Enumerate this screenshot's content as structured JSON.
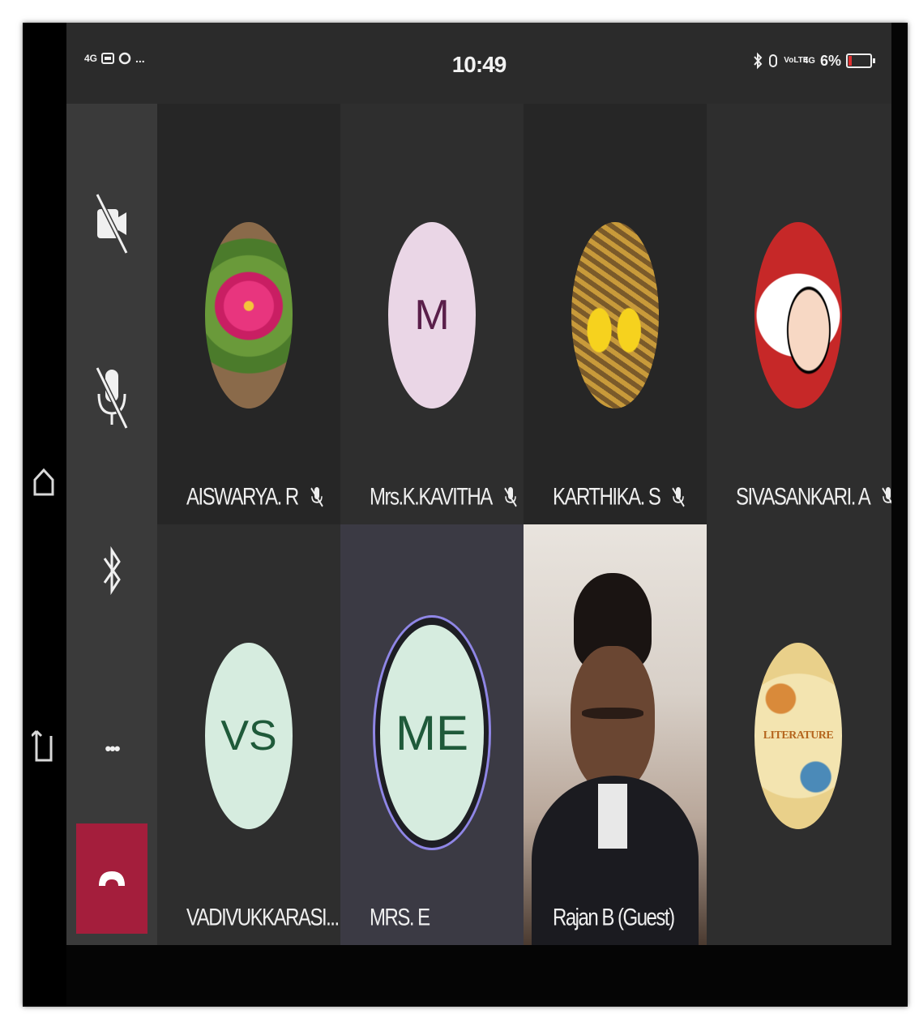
{
  "status_bar": {
    "left_indicators": [
      "4G",
      "msg",
      "whatsapp",
      "..."
    ],
    "time": "10:49",
    "right_indicators": [
      "bluetooth",
      "alarm",
      "VoLTE",
      "4G"
    ],
    "battery_percent": "6%"
  },
  "controls": [
    {
      "id": "camera",
      "icon": "camera-off-icon"
    },
    {
      "id": "microphone",
      "icon": "mic-off-icon"
    },
    {
      "id": "bluetooth",
      "icon": "bluetooth-icon"
    },
    {
      "id": "more",
      "icon": "more-icon",
      "label": "•••"
    },
    {
      "id": "hangup",
      "icon": "hangup-icon",
      "color": "#a41e3c"
    }
  ],
  "participants": [
    {
      "name": "AISWARYA. R",
      "avatar": "flower-photo",
      "muted": true
    },
    {
      "name": "Mrs.K.KAVITHA",
      "initials": "M",
      "avatar_color": "#ead6e6",
      "initials_color": "#5a1f4a",
      "muted": true
    },
    {
      "name": "KARTHIKA. S",
      "avatar": "chicks-photo",
      "muted": true
    },
    {
      "name": "SIVASANKARI. A",
      "avatar": "cartoon-photo",
      "muted": true
    },
    {
      "name": "VADIVUKKARASI...",
      "initials": "VS",
      "avatar_color": "#d6ecdf",
      "initials_color": "#1f5a3a",
      "muted": true
    },
    {
      "name": "MRS. E",
      "initials": "ME",
      "avatar_color": "#d6ecdf",
      "initials_color": "#1f5a3a",
      "muted": false,
      "speaking": true
    },
    {
      "name": "Rajan B (Guest)",
      "avatar": "video-feed",
      "muted": false
    },
    {
      "name": "",
      "avatar": "literature-photo",
      "avatar_text": "LITERATURE",
      "muted": false
    }
  ]
}
